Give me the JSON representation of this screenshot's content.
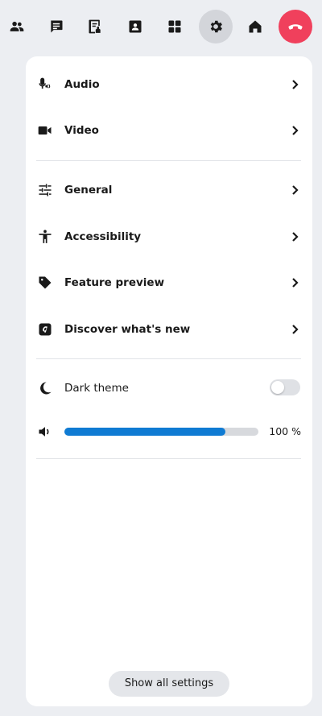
{
  "toolbar": {
    "buttons": [
      {
        "icon": "people-icon",
        "active": false
      },
      {
        "icon": "chat-icon",
        "active": false
      },
      {
        "icon": "notes-icon",
        "active": false
      },
      {
        "icon": "contact-card-icon",
        "active": false
      },
      {
        "icon": "apps-grid-icon",
        "active": false
      },
      {
        "icon": "gear-icon",
        "active": true
      },
      {
        "icon": "home-icon",
        "active": false
      },
      {
        "icon": "phone-hangup-icon",
        "active": false
      }
    ],
    "hangup_color": "#f0405c"
  },
  "settings_menu": {
    "groups": [
      {
        "items": [
          {
            "label": "Audio",
            "icon": "microphone-icon"
          },
          {
            "label": "Video",
            "icon": "video-camera-icon"
          }
        ]
      },
      {
        "items": [
          {
            "label": "General",
            "icon": "sliders-icon"
          },
          {
            "label": "Accessibility",
            "icon": "accessibility-icon"
          },
          {
            "label": "Feature preview",
            "icon": "tag-icon"
          },
          {
            "label": "Discover what's new",
            "icon": "discover-icon"
          }
        ]
      }
    ]
  },
  "quick_settings": {
    "dark_theme": {
      "label": "Dark theme",
      "enabled": false,
      "icon": "moon-icon"
    },
    "volume": {
      "value_text": "100 %",
      "level": 0.83,
      "icon": "speaker-icon",
      "fill_color": "#0f7bd3"
    }
  },
  "footer": {
    "show_all_label": "Show all settings"
  }
}
